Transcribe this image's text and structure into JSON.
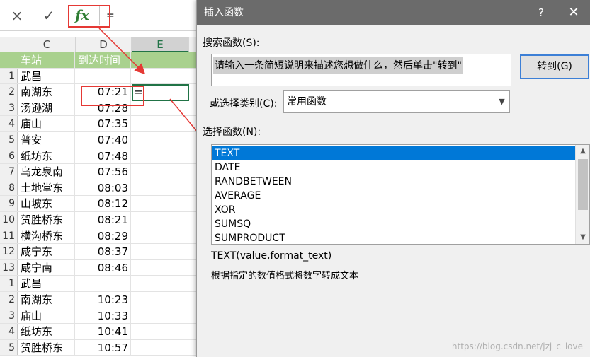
{
  "formula_bar": {
    "cancel_icon": "×",
    "confirm_icon": "✓",
    "fx_label": "fx",
    "input_value": "="
  },
  "columns": [
    "C",
    "D",
    "E"
  ],
  "sheet": {
    "header": {
      "col_c": "车站",
      "col_d": "到达时间",
      "col_e": ""
    },
    "rows": [
      {
        "rn": "1",
        "c": "武昌",
        "d": "",
        "e": ""
      },
      {
        "rn": "2",
        "c": "南湖东",
        "d": "07:21",
        "e": "="
      },
      {
        "rn": "3",
        "c": "汤逊湖",
        "d": "07:28",
        "e": ""
      },
      {
        "rn": "4",
        "c": "庙山",
        "d": "07:35",
        "e": ""
      },
      {
        "rn": "5",
        "c": "普安",
        "d": "07:40",
        "e": ""
      },
      {
        "rn": "6",
        "c": "纸坊东",
        "d": "07:48",
        "e": ""
      },
      {
        "rn": "7",
        "c": "乌龙泉南",
        "d": "07:56",
        "e": ""
      },
      {
        "rn": "8",
        "c": "土地堂东",
        "d": "08:03",
        "e": ""
      },
      {
        "rn": "9",
        "c": "山坡东",
        "d": "08:12",
        "e": ""
      },
      {
        "rn": "10",
        "c": "贺胜桥东",
        "d": "08:21",
        "e": ""
      },
      {
        "rn": "11",
        "c": "横沟桥东",
        "d": "08:29",
        "e": ""
      },
      {
        "rn": "12",
        "c": "咸宁东",
        "d": "08:37",
        "e": ""
      },
      {
        "rn": "13",
        "c": "咸宁南",
        "d": "08:46",
        "e": ""
      },
      {
        "rn": "1",
        "c": "武昌",
        "d": "",
        "e": ""
      },
      {
        "rn": "2",
        "c": "南湖东",
        "d": "10:23",
        "e": ""
      },
      {
        "rn": "3",
        "c": "庙山",
        "d": "10:33",
        "e": ""
      },
      {
        "rn": "4",
        "c": "纸坊东",
        "d": "10:41",
        "e": ""
      },
      {
        "rn": "5",
        "c": "贺胜桥东",
        "d": "10:57",
        "e": ""
      }
    ]
  },
  "dialog": {
    "title": "插入函数",
    "help_label": "?",
    "close_label": "✕",
    "search_label": "搜索函数(S):",
    "search_value": "请输入一条简短说明来描述您想做什么，然后单击\"转到\"",
    "goto_button": "转到(G)",
    "category_label": "或选择类别(C):",
    "category_value": "常用函数",
    "function_list_label": "选择函数(N):",
    "functions": [
      "TEXT",
      "DATE",
      "RANDBETWEEN",
      "AVERAGE",
      "XOR",
      "SUMSQ",
      "SUMPRODUCT"
    ],
    "selected_function": "TEXT",
    "syntax": "TEXT(value,format_text)",
    "description": "根据指定的数值格式将数字转成文本"
  },
  "watermark": "https://blog.csdn.net/jzj_c_love",
  "colors": {
    "header_green": "#a9d18e",
    "selection_blue": "#0078d7",
    "annotation_red": "#e53935",
    "titlebar_gray": "#6b6b6b"
  }
}
